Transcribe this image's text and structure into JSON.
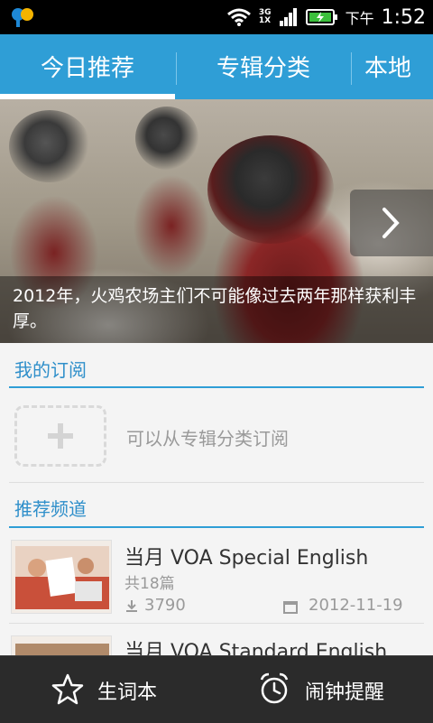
{
  "status_bar": {
    "network_top": "3G",
    "network_bottom": "1X",
    "time_prefix": "下午",
    "time": "1:52",
    "icons": [
      "app-notification-icon",
      "wifi-icon",
      "signal-icon",
      "battery-charging-icon"
    ]
  },
  "tabs": [
    {
      "label": "今日推荐",
      "active": true
    },
    {
      "label": "专辑分类",
      "active": false
    },
    {
      "label": "本地",
      "active": false
    }
  ],
  "banner": {
    "caption": "2012年，火鸡农场主们不可能像过去两年那样获利丰厚。",
    "next_icon": "chevron-right-icon"
  },
  "subscriptions": {
    "title": "我的订阅",
    "add_hint": "可以从专辑分类订阅"
  },
  "recommended": {
    "title": "推荐频道",
    "channels": [
      {
        "title": "当月 VOA Special English",
        "count": "共18篇",
        "downloads": "3790",
        "date": "2012-11-19"
      },
      {
        "title": "当月 VOA Standard English",
        "count": "",
        "downloads": "",
        "date": ""
      }
    ]
  },
  "bottom_bar": {
    "vocab_label": "生词本",
    "alarm_label": "闹钟提醒"
  },
  "colors": {
    "accent": "#2f9ed6",
    "bottom_bar": "#2b2b2b"
  }
}
